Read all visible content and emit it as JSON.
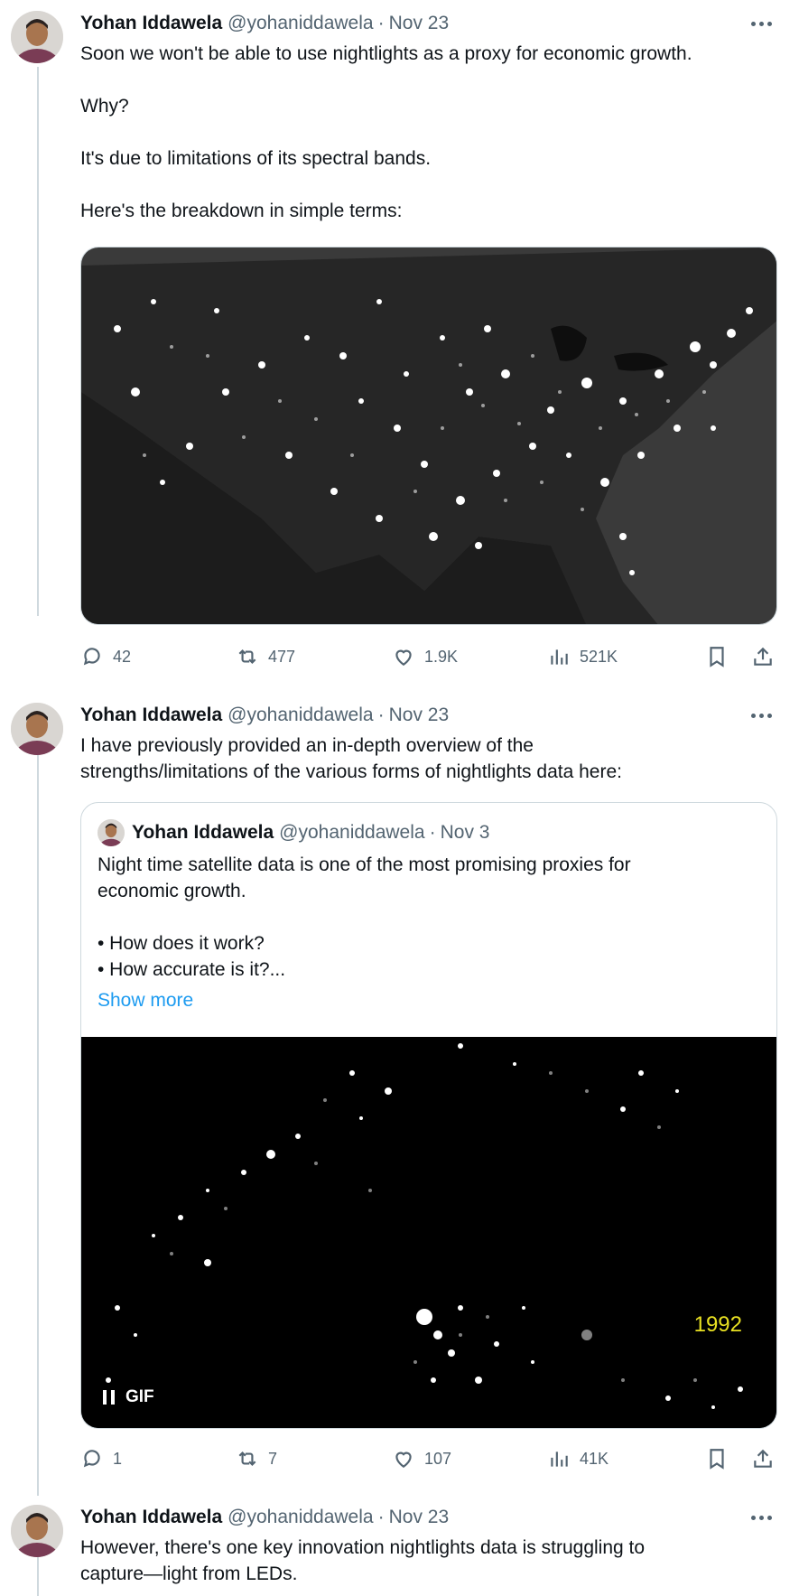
{
  "tweets": [
    {
      "name": "Yohan Iddawela",
      "handle": "@yohaniddawela",
      "separator": "·",
      "date": "Nov 23",
      "text": "Soon we won't be able to use nightlights as a proxy for economic growth.\n\nWhy?\n\nIt's due to limitations of its spectral bands.\n\nHere's the breakdown in simple terms:",
      "stats": {
        "replies": "42",
        "retweets": "477",
        "likes": "1.9K",
        "views": "521K"
      }
    },
    {
      "name": "Yohan Iddawela",
      "handle": "@yohaniddawela",
      "separator": "·",
      "date": "Nov 23",
      "text": "I have previously provided an in-depth overview of the\nstrengths/limitations of the various forms of nightlights data here:",
      "quote": {
        "name": "Yohan Iddawela",
        "handle": "@yohaniddawela",
        "separator": "·",
        "date": "Nov 3",
        "text": "Night time satellite data is one of the most promising proxies for\neconomic growth.\n\n• How does it work?\n• How accurate is it?...",
        "show_more": "Show more",
        "gif_label": "GIF",
        "year_label": "1992"
      },
      "stats": {
        "replies": "1",
        "retweets": "7",
        "likes": "107",
        "views": "41K"
      }
    },
    {
      "name": "Yohan Iddawela",
      "handle": "@yohaniddawela",
      "separator": "·",
      "date": "Nov 23",
      "text": "However, there's one key innovation nightlights data is struggling to\ncapture—light from LEDs."
    }
  ],
  "icons": {
    "reply": "reply-icon",
    "retweet": "retweet-icon",
    "like": "heart-icon",
    "views": "views-chart-icon",
    "bookmark": "bookmark-icon",
    "share": "share-icon",
    "more": "more-dots-icon"
  },
  "colors": {
    "link": "#1d9bf0",
    "muted": "#536471",
    "year_label": "#e8e022"
  }
}
